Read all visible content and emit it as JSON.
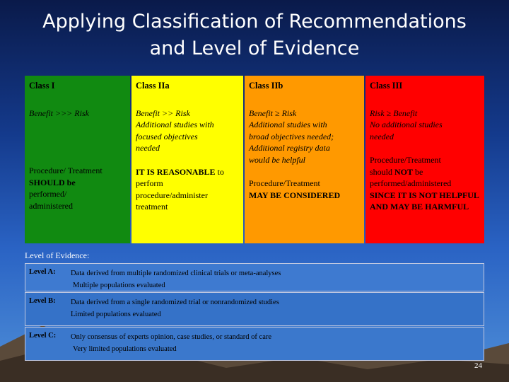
{
  "title": {
    "line1": "Applying Classification of Recommendations",
    "line2": "and Level of Evidence"
  },
  "classes": [
    {
      "name": "Class I",
      "p1": [
        "Benefit >>> Risk"
      ],
      "p2": [
        "Procedure/ Treatment",
        "SHOULD be",
        "performed/",
        "administered"
      ]
    },
    {
      "name": "Class IIa",
      "p1": [
        "Benefit >> Risk",
        "Additional studies with",
        "focused objectives",
        "needed"
      ],
      "p2": [
        "IT IS REASONABLE",
        "to",
        "perform",
        "procedure/administer",
        "treatment"
      ]
    },
    {
      "name": "Class IIb",
      "p1": [
        "Benefit ≥ Risk",
        "Additional studies with",
        "broad objectives needed;",
        "Additional registry data",
        "would be helpful"
      ],
      "p2": [
        "Procedure/Treatment",
        "MAY BE CONSIDERED"
      ]
    },
    {
      "name": "Class III",
      "p1": [
        "Risk ≥ Benefit",
        "No additional studies",
        "needed"
      ],
      "p2": [
        "Procedure/Treatment",
        "should",
        "NOT",
        "be",
        "performed/administered",
        "SINCE IT IS NOT HELPFUL",
        "AND MAY BE HARMFUL"
      ]
    }
  ],
  "level_of_evidence": {
    "label": "Level of Evidence:",
    "levels": [
      {
        "level": "Level A:",
        "line1": "Data derived from multiple randomized clinical trials or meta-analyses",
        "line2": "Multiple populations evaluated"
      },
      {
        "level": "Level B:",
        "line1": "Data derived from a single randomized trial or nonrandomized studies",
        "line2": "Limited populations evaluated"
      },
      {
        "level": "Level C:",
        "line1": "Only consensus of experts opinion, case studies, or standard of care",
        "line2": "Very limited populations evaluated"
      }
    ]
  },
  "page_number": "24",
  "colors": {
    "class_i": "#118a11",
    "class_iia": "#ffff00",
    "class_iib": "#ff9900",
    "class_iii": "#ff0000"
  }
}
